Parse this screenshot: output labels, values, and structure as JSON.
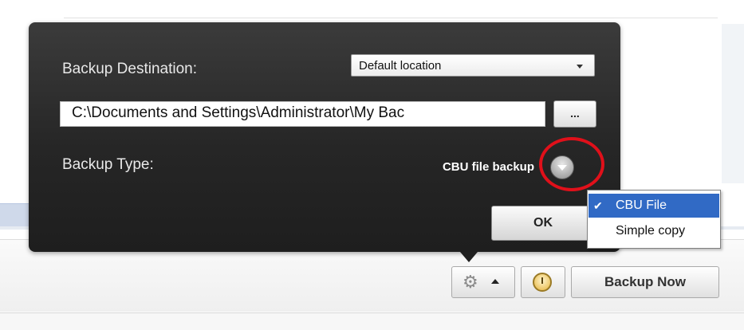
{
  "popup": {
    "destination_label": "Backup Destination:",
    "destination_select": "Default location",
    "path_value": "C:\\Documents and Settings\\Administrator\\My Bac",
    "browse_label": "...",
    "type_label": "Backup Type:",
    "type_value": "CBU file backup",
    "ok_label": "OK"
  },
  "dropdown": {
    "selected": "CBU File",
    "option": "Simple copy",
    "check": "✔"
  },
  "toolbar": {
    "backup_now_label": "Backup Now",
    "gear_glyph": "⚙"
  },
  "colors": {
    "highlight": "#e0101a",
    "menu_selected": "#316ac5"
  },
  "icons": [
    "settings-gear-icon",
    "chevron-up-icon",
    "alarm-clock-icon",
    "chevron-down-icon",
    "checkmark-icon"
  ]
}
